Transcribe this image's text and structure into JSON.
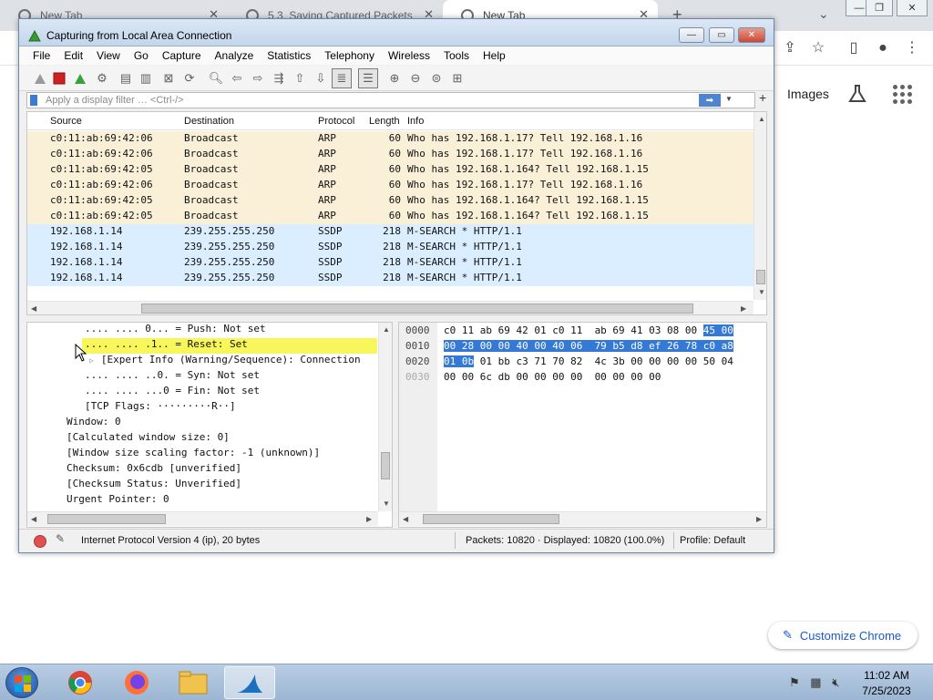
{
  "browser": {
    "tabs": [
      {
        "label": "New Tab"
      },
      {
        "label": "5.3. Saving Captured Packets"
      },
      {
        "label": "New Tab"
      }
    ],
    "new_tab_label": "+",
    "images_link": "Images",
    "customize_label": "Customize Chrome"
  },
  "window": {
    "title": "Capturing from Local Area Connection"
  },
  "menu": [
    "File",
    "Edit",
    "View",
    "Go",
    "Capture",
    "Analyze",
    "Statistics",
    "Telephony",
    "Wireless",
    "Tools",
    "Help"
  ],
  "filter": {
    "placeholder": "Apply a display filter … <Ctrl-/>",
    "value": ""
  },
  "packet_list": {
    "columns": [
      "Source",
      "Destination",
      "Protocol",
      "Length",
      "Info"
    ],
    "rows": [
      {
        "source": "c0:11:ab:69:42:06",
        "destination": "Broadcast",
        "protocol": "ARP",
        "length": "60",
        "info": "Who has 192.168.1.17? Tell 192.168.1.16",
        "kind": "arp"
      },
      {
        "source": "c0:11:ab:69:42:06",
        "destination": "Broadcast",
        "protocol": "ARP",
        "length": "60",
        "info": "Who has 192.168.1.17? Tell 192.168.1.16",
        "kind": "arp"
      },
      {
        "source": "c0:11:ab:69:42:05",
        "destination": "Broadcast",
        "protocol": "ARP",
        "length": "60",
        "info": "Who has 192.168.1.164? Tell 192.168.1.15",
        "kind": "arp"
      },
      {
        "source": "c0:11:ab:69:42:06",
        "destination": "Broadcast",
        "protocol": "ARP",
        "length": "60",
        "info": "Who has 192.168.1.17? Tell 192.168.1.16",
        "kind": "arp"
      },
      {
        "source": "c0:11:ab:69:42:05",
        "destination": "Broadcast",
        "protocol": "ARP",
        "length": "60",
        "info": "Who has 192.168.1.164? Tell 192.168.1.15",
        "kind": "arp"
      },
      {
        "source": "c0:11:ab:69:42:05",
        "destination": "Broadcast",
        "protocol": "ARP",
        "length": "60",
        "info": "Who has 192.168.1.164? Tell 192.168.1.15",
        "kind": "arp"
      },
      {
        "source": "192.168.1.14",
        "destination": "239.255.255.250",
        "protocol": "SSDP",
        "length": "218",
        "info": "M-SEARCH * HTTP/1.1",
        "kind": "ssdp"
      },
      {
        "source": "192.168.1.14",
        "destination": "239.255.255.250",
        "protocol": "SSDP",
        "length": "218",
        "info": "M-SEARCH * HTTP/1.1",
        "kind": "ssdp"
      },
      {
        "source": "192.168.1.14",
        "destination": "239.255.255.250",
        "protocol": "SSDP",
        "length": "218",
        "info": "M-SEARCH * HTTP/1.1",
        "kind": "ssdp"
      },
      {
        "source": "192.168.1.14",
        "destination": "239.255.255.250",
        "protocol": "SSDP",
        "length": "218",
        "info": "M-SEARCH * HTTP/1.1",
        "kind": "ssdp"
      }
    ]
  },
  "details": {
    "lines": [
      ".... .... 0... = Push: Not set",
      ".... .... .1.. = Reset: Set",
      "[Expert Info (Warning/Sequence): Connection",
      ".... .... ..0. = Syn: Not set",
      ".... .... ...0 = Fin: Not set",
      "[TCP Flags: ·········R··]",
      "Window: 0",
      "[Calculated window size: 0]",
      "[Window size scaling factor: -1 (unknown)]",
      "Checksum: 0x6cdb [unverified]",
      "[Checksum Status: Unverified]",
      "Urgent Pointer: 0"
    ]
  },
  "bytes": {
    "offsets": [
      "0000",
      "0010",
      "0020",
      "0030"
    ],
    "line0_plain": "c0 11 ab 69 42 01 c0 11  ab 69 41 03 08 00 ",
    "line0_sel": "45 00",
    "line1_sel": "00 28 00 00 40 00 40 06  79 b5 d8 ef 26 78 c0 a8",
    "line2_sel": "01 0b",
    "line2_plain": " 01 bb c3 71 70 82  4c 3b 00 00 00 00 50 04",
    "line3_plain": "00 00 6c db 00 00 00 00  00 00 00 00"
  },
  "status": {
    "message": "Internet Protocol Version 4 (ip), 20 bytes",
    "packets": "Packets: 10820 · Displayed: 10820 (100.0%)",
    "profile": "Profile: Default"
  },
  "taskbar": {
    "time": "11:02 AM",
    "date": "7/25/2023"
  },
  "colors": {
    "arp_row": "#faf0d7",
    "ssdp_row": "#daeeff",
    "highlight": "#f7f65a",
    "byte_selection": "#3579d6",
    "accent": "#1a57c6"
  },
  "icons": {
    "toolbar": [
      "shark-fin-icon",
      "stop-icon",
      "restart-icon",
      "options-gear-icon",
      "open-file-icon",
      "save-file-icon",
      "close-file-icon",
      "reload-file-icon",
      "find-packet-icon",
      "go-back-icon",
      "go-forward-icon",
      "go-to-packet-icon",
      "first-packet-icon",
      "last-packet-icon",
      "autoscroll-icon",
      "colorize-icon",
      "zoom-in-icon",
      "zoom-out-icon",
      "normal-size-icon",
      "resize-columns-icon"
    ]
  }
}
